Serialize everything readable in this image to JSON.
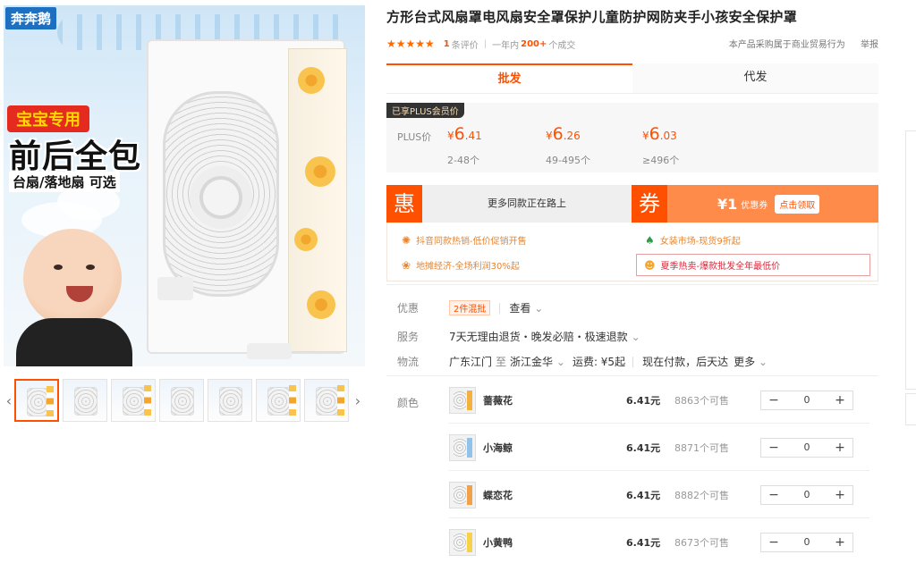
{
  "gallery": {
    "brand": "奔奔鹅",
    "promo_tag": "宝宝专用",
    "promo_big": "前后全包",
    "promo_sub": "台扇/落地扇 可选",
    "thumbs_count_note": "",
    "prev_arrow": "‹",
    "next_arrow": "›"
  },
  "product": {
    "title": "方形台式风扇罩电风扇安全罩保护儿童防护网防夹手小孩安全保护罩",
    "stars": "★★★★★",
    "reviews_num": "1",
    "reviews_label": "条评价",
    "year_label": "一年内",
    "sold_num": "200+",
    "sold_label": "个成交",
    "purchase_note": "本产品采购属于商业贸易行为",
    "report": "举报"
  },
  "tabs": [
    "批发",
    "代发"
  ],
  "price": {
    "plus_tag": "已享PLUS会员价",
    "plus_label": "PLUS价",
    "currency": "¥",
    "tiers": [
      {
        "int": "6",
        "dec": ".41",
        "range": "2-48个"
      },
      {
        "int": "6",
        "dec": ".26",
        "range": "49-495个"
      },
      {
        "int": "6",
        "dec": ".03",
        "range": "≥496个"
      }
    ]
  },
  "promo": {
    "hui_badge": "惠",
    "hui_text": "更多同款正在路上",
    "quan_badge": "券",
    "coupon_amount": "¥1",
    "coupon_label": "优惠券",
    "coupon_button": "点击领取"
  },
  "market": [
    {
      "icon": "✺",
      "text": "抖音同款热销-低价促销开售"
    },
    {
      "icon": "♠",
      "text": "女装市场-现货9折起"
    },
    {
      "icon": "❀",
      "text": "地摊经济-全场利润30%起"
    },
    {
      "icon": "☻",
      "text": "夏季热卖-爆款批发全年最低价"
    }
  ],
  "attrs": {
    "discount_label": "优惠",
    "discount_tag": "2件混批",
    "discount_view": "查看",
    "service_label": "服务",
    "service_text": "7天无理由退货・晚发必赔・极速退款",
    "logistics_label": "物流",
    "logistics_from": "广东江门",
    "logistics_to_word": "至",
    "logistics_to": "浙江金华",
    "shipping": "运费: ¥5起",
    "delivery": "现在付款，后天达",
    "more": "更多"
  },
  "sku": {
    "color_label": "颜色",
    "items": [
      {
        "name": "蔷薇花",
        "price": "6.41元",
        "stock": "8863个可售",
        "qty": "0"
      },
      {
        "name": "小海鲸",
        "price": "6.41元",
        "stock": "8871个可售",
        "qty": "0"
      },
      {
        "name": "蝶恋花",
        "price": "6.41元",
        "stock": "8882个可售",
        "qty": "0"
      },
      {
        "name": "小黄鸭",
        "price": "6.41元",
        "stock": "8673个可售",
        "qty": "0"
      }
    ],
    "minus": "−",
    "plus": "+"
  },
  "colors": {
    "accent": "#ff5000",
    "coupon_bg": "#ff8b4a",
    "brand_blue": "#1e6fbf"
  }
}
